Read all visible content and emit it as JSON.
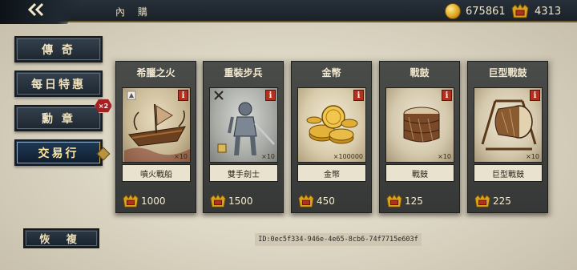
{
  "header": {
    "title": "內 購",
    "back_icon": "chevron-left-icon",
    "gold_amount": "675861",
    "gem_amount": "4313"
  },
  "menu": {
    "items": [
      {
        "label": "傳 奇"
      },
      {
        "label": "每日特惠"
      },
      {
        "label": "勳 章",
        "badge": "×2"
      },
      {
        "label": "交易行",
        "selected": true
      }
    ],
    "restore_label": "恢 複"
  },
  "shop": {
    "items": [
      {
        "title": "希臘之火",
        "name": "噴火戰船",
        "quantity": "×10",
        "price": "1000",
        "icon": "fire-ship-icon"
      },
      {
        "title": "重裝步兵",
        "name": "雙手劍士",
        "quantity": "×10",
        "price": "1500",
        "icon": "knight-icon"
      },
      {
        "title": "金幣",
        "name": "金幣",
        "quantity": "×100000",
        "price": "450",
        "icon": "gold-coins-icon"
      },
      {
        "title": "戰鼓",
        "name": "戰鼓",
        "quantity": "×10",
        "price": "125",
        "icon": "war-drum-icon"
      },
      {
        "title": "巨型戰鼓",
        "name": "巨型戰鼓",
        "quantity": "×10",
        "price": "225",
        "icon": "giant-drum-icon"
      }
    ]
  },
  "footer": {
    "id_text": "ID:0ec5f334-946e-4e65-8cb6-74f7715e603f"
  },
  "colors": {
    "gold": "#d9a21c",
    "gem_red": "#b3301f",
    "panel_dark": "#3f4140",
    "accent": "#c9a54a"
  }
}
